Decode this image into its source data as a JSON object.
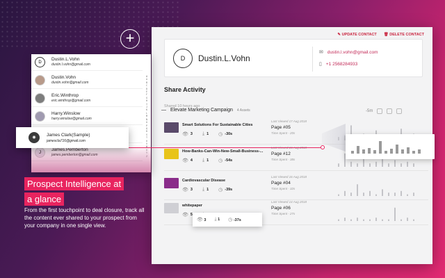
{
  "colors": {
    "accent": "#e8245f",
    "panel_bg": "#f3f3f4",
    "link": "#c22a57"
  },
  "top_actions": {
    "update": "UPDATE CONTACT",
    "delete": "DELETE CONTACT"
  },
  "contact": {
    "initial": "D",
    "name": "Dustin.L.Vohn",
    "email": "dustin.l.vohn@gmail.com",
    "phone": "+1 2568284933"
  },
  "share_activity": {
    "title": "Share Activity",
    "shared_ago": "Shared 10 hours ago",
    "campaign": "Elevate Marketing Campaign",
    "assets_count": "4 Assets",
    "duration": "-5m",
    "items": [
      {
        "name": "Smart Solutions For Sustainable Cities",
        "views": "3",
        "downloads": "1",
        "time": "-30s",
        "last_viewed": "Last Viewed 17 Aug 2018",
        "page": "Page #05",
        "time_spent": "Time Spent - 20s",
        "thumb": "#5a4a6a"
      },
      {
        "name": "How-Banks-Can-Win-New-Small-Business-...",
        "views": "4",
        "downloads": "1",
        "time": "-54s",
        "last_viewed": "Last Viewed 16 Aug 2018",
        "page": "Page #12",
        "time_spent": "Time Spent - 38s",
        "thumb": "#e8c41a"
      },
      {
        "name": "Cardiovascular Disease",
        "views": "3",
        "downloads": "1",
        "time": "-39s",
        "last_viewed": "Last Viewed 16 Aug 2018",
        "page": "Page #04",
        "time_spent": "Time Spent - 32s",
        "thumb": "#8a2c8a"
      },
      {
        "name": "whitepaper",
        "views": "5",
        "downloads": "1",
        "time": "-37s",
        "last_viewed": "Last Viewed 14 Aug 2018",
        "page": "Page #06",
        "time_spent": "Time Spent - 27s",
        "thumb": "#cfcfd4"
      }
    ]
  },
  "stat_popup": {
    "views": "3",
    "downloads": "1",
    "time": "-37s"
  },
  "contacts": [
    {
      "initial": "D",
      "name": "Dustin.L.Vohn",
      "email": "dustin.l.vohn@gmail.com"
    },
    {
      "initial": "",
      "name": "Dustin.Vohn",
      "email": "dustin.vohn@gmail.com"
    },
    {
      "initial": "",
      "name": "Eric.Winthrop",
      "email": "eric.winthrop@gmail.com"
    },
    {
      "initial": "",
      "name": "Harry.Winslow",
      "email": "harry.winslow@gmail.com"
    },
    {
      "initial": "",
      "name": "James Clark(Sample)",
      "email": "jamesclark@gmail.com"
    },
    {
      "initial": "J",
      "name": "James.Pemberton",
      "email": "james.pemberton@gmail.com"
    }
  ],
  "alphabet": "#ABCDEFGHIJKLMNOPQRSTUVWXYZ",
  "highlight_contact": {
    "name": "James Clark(Sample)",
    "email": "jamescla716@gmail.com"
  },
  "promo": {
    "headline_line1": "Prospect Intelligence at",
    "headline_line2": "a glance",
    "description": "From the first touchpoint to deal closure, track all the content ever shared to your prospect from your company in one single view."
  },
  "icons": {
    "plus": "plus-icon",
    "mail": "mail-icon",
    "phone": "phone-icon",
    "eye": "eye-icon",
    "download": "download-icon",
    "clock": "clock-icon"
  }
}
